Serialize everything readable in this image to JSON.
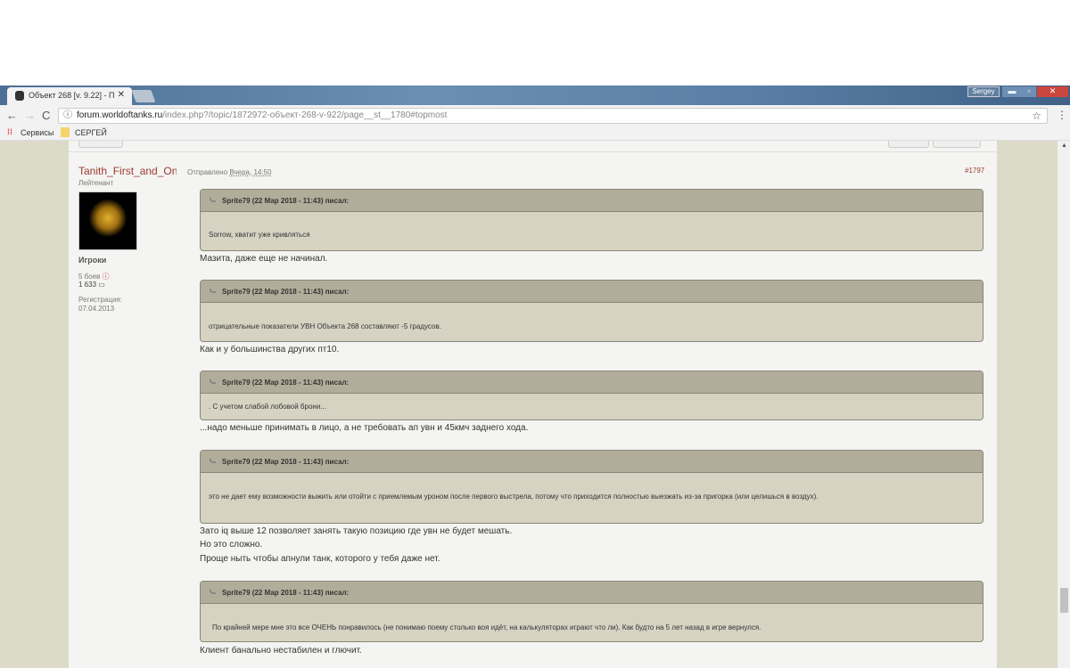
{
  "browser": {
    "tab_title": "Объект 268 [v. 9.22] - П",
    "user": "Sergey",
    "url_domain": "forum.worldoftanks.ru",
    "url_path": "/index.php?/topic/1872972-объект-268-v-922/page__st__1780#topmost",
    "bookmarks": [
      "Сервисы",
      "СЕРГЕЙ"
    ]
  },
  "post": {
    "author": "Tanith_First_and_On",
    "rank": "Лейтенант",
    "group": "Игроки",
    "battles": "5 боев",
    "posts": "1 633",
    "reg_label": "Регистрация:",
    "reg_date": "07.04.2013",
    "sent_label": "Отправлено",
    "sent_time": "Вчера, 14:50",
    "number": "#1797",
    "blocks": [
      {
        "quote_header": "Sprite79 (22 Мар 2018 - 11:43) писал:",
        "quote": "Sorrow, хватит уже кривляться",
        "reply": [
          "Мазита, даже еще не начинал."
        ]
      },
      {
        "quote_header": "Sprite79 (22 Мар 2018 - 11:43) писал:",
        "quote": "отрицательные показатели УВН Объекта 268 составляют -5 градусов.",
        "reply": [
          "Как и у большинства других пт10."
        ]
      },
      {
        "quote_header": "Sprite79 (22 Мар 2018 - 11:43) писал:",
        "quote": ". С учетом слабой лобовой брони...",
        "reply": [
          "...надо меньше принимать в лицо, а не требовать ап увн и 45кмч заднего хода."
        ]
      },
      {
        "quote_header": "Sprite79 (22 Мар 2018 - 11:43) писал:",
        "quote": "это не дает ему возможности выжить или отойти с приемлемым уроном после первого выстрела, потому что приходится полностью выезжать из-за пригорка (или целишься в воздух).",
        "reply": [
          "Зато iq выше 12 позволяет занять такую позицию где увн не будет мешать.",
          "Но это сложно.",
          "Проще ныть чтобы апнули танк, которого у тебя даже нет."
        ]
      },
      {
        "quote_header": "Sprite79 (22 Мар 2018 - 11:43) писал:",
        "quote": "По крайней мере мне это все ОЧЕНЬ понравилось (не понимаю поему столько воя идёт, на калькуляторах играют что ли).  Как будто на 5 лет назад в игре вернулся.",
        "reply": [
          "Клиент банально нестабилен и глючит."
        ]
      }
    ]
  }
}
